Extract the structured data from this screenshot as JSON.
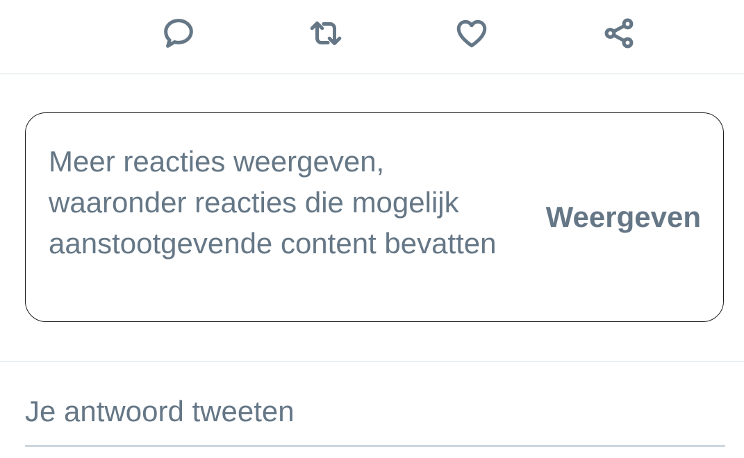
{
  "actions": {
    "reply_icon": "reply-bubble",
    "retweet_icon": "retweet-arrows",
    "like_icon": "heart",
    "share_icon": "share-nodes"
  },
  "notice": {
    "text": "Meer reacties weergeven, waaronder reacties die mogelijk aanstootgevende content bevatten",
    "button_label": "Weergeven"
  },
  "reply": {
    "placeholder": "Je antwoord tweeten"
  },
  "colors": {
    "text_secondary": "#657786",
    "divider": "#d6e0e6",
    "card_border": "#1c1c1c",
    "background": "#ffffff"
  }
}
